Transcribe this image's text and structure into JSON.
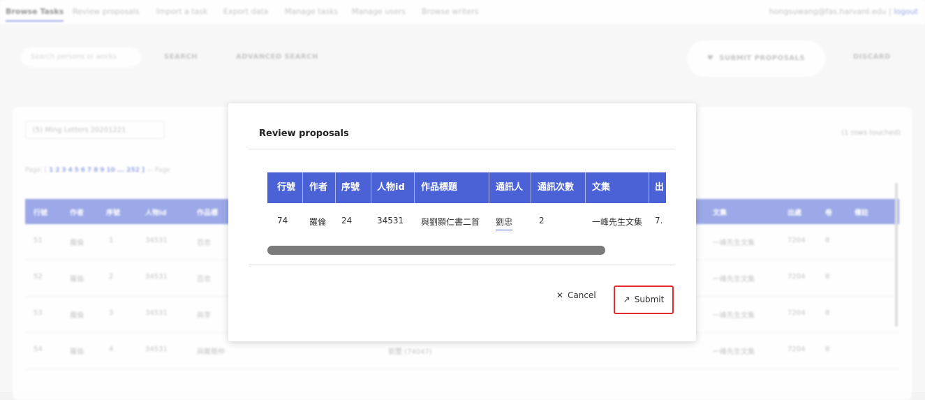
{
  "nav": {
    "items": [
      "Browse Tasks",
      "Review proposals",
      "Import a task",
      "Export data",
      "Manage tasks",
      "Manage users",
      "Browse writers"
    ],
    "user_email": "hongsuwang@fas.harvard.edu",
    "logout": "logout"
  },
  "search": {
    "placeholder": "Search persons or works",
    "search_label": "SEARCH",
    "advanced_label": "ADVANCED SEARCH",
    "submit_proposals_label": "SUBMIT PROPOSALS",
    "discard_label": "DISCARD"
  },
  "task": {
    "selected": "(5) Ming Letters 20201221",
    "rows_touched": "(1 rows touched)",
    "pager_prefix": "Page: [",
    "pages": [
      "1",
      "2",
      "3",
      "4",
      "5",
      "6",
      "7",
      "8",
      "9",
      "10"
    ],
    "pager_more": "... 252 ]",
    "pager_suffix": "— Page"
  },
  "background_table": {
    "columns": [
      "行號",
      "作者",
      "序號",
      "人物id",
      "作品標",
      "文集",
      "出處",
      "卷",
      "備註"
    ],
    "rows": [
      {
        "line": "51",
        "author": "羅倫",
        "seq": "1",
        "pid": "34531",
        "title": "百忠",
        "collection": "一峰先生文集",
        "src": "7204",
        "vol": "8"
      },
      {
        "line": "52",
        "author": "羅倫",
        "seq": "2",
        "pid": "34531",
        "title": "百忠",
        "collection": "一峰先生文集",
        "src": "7204",
        "vol": "8"
      },
      {
        "line": "53",
        "author": "羅倫",
        "seq": "3",
        "pid": "34531",
        "title": "與李",
        "collection": "一峰先生文集",
        "src": "7204",
        "vol": "8"
      },
      {
        "line": "54",
        "author": "羅倫",
        "seq": "4",
        "pid": "34531",
        "title": "與戴簡仲",
        "person": "劉璽 (74047)",
        "collection": "一峰先生文集",
        "src": "7204",
        "vol": "8"
      }
    ]
  },
  "modal": {
    "title": "Review proposals",
    "columns": [
      "行號",
      "作者",
      "序號",
      "人物id",
      "作品標題",
      "通訊人",
      "通訊次數",
      "文集",
      "出"
    ],
    "row": [
      "74",
      "羅倫",
      "24",
      "34531",
      "與劉顥仁書二首",
      "劉忠",
      "2",
      "一峰先生文集",
      "7."
    ],
    "cancel_label": "Cancel",
    "submit_label": "Submit"
  }
}
